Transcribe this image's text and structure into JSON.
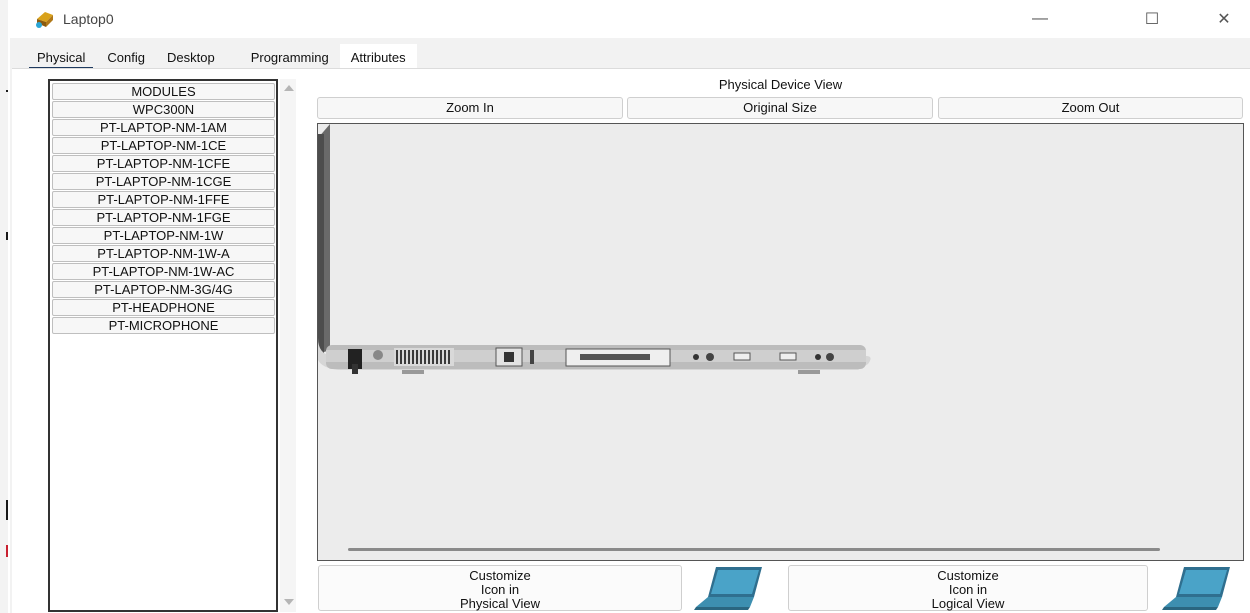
{
  "window": {
    "title": "Laptop0",
    "controls": {
      "minimize": "—",
      "maximize": "☐",
      "close": "✕"
    }
  },
  "tabs": [
    {
      "label": "Physical",
      "active": true
    },
    {
      "label": "Config",
      "active": false
    },
    {
      "label": "Desktop",
      "active": false
    },
    {
      "label": "Programming",
      "active": false
    },
    {
      "label": "Attributes",
      "active": false
    }
  ],
  "modules": {
    "header": "MODULES",
    "items": [
      "WPC300N",
      "PT-LAPTOP-NM-1AM",
      "PT-LAPTOP-NM-1CE",
      "PT-LAPTOP-NM-1CFE",
      "PT-LAPTOP-NM-1CGE",
      "PT-LAPTOP-NM-1FFE",
      "PT-LAPTOP-NM-1FGE",
      "PT-LAPTOP-NM-1W",
      "PT-LAPTOP-NM-1W-A",
      "PT-LAPTOP-NM-1W-AC",
      "PT-LAPTOP-NM-3G/4G",
      "PT-HEADPHONE",
      "PT-MICROPHONE"
    ]
  },
  "physical_view": {
    "title": "Physical Device View",
    "zoom_in": "Zoom In",
    "original_size": "Original Size",
    "zoom_out": "Zoom Out"
  },
  "customize": {
    "physical": {
      "line1": "Customize",
      "line2": "Icon in",
      "line3": "Physical View"
    },
    "logical": {
      "line1": "Customize",
      "line2": "Icon in",
      "line3": "Logical View"
    }
  },
  "icons": {
    "app": "packet-tracer-laptop-icon",
    "laptop": "laptop-icon"
  },
  "colors": {
    "tab_underline": "#1e3a5f",
    "laptop_screen": "#3d8fb0",
    "laptop_body": "#5a5a5a"
  }
}
